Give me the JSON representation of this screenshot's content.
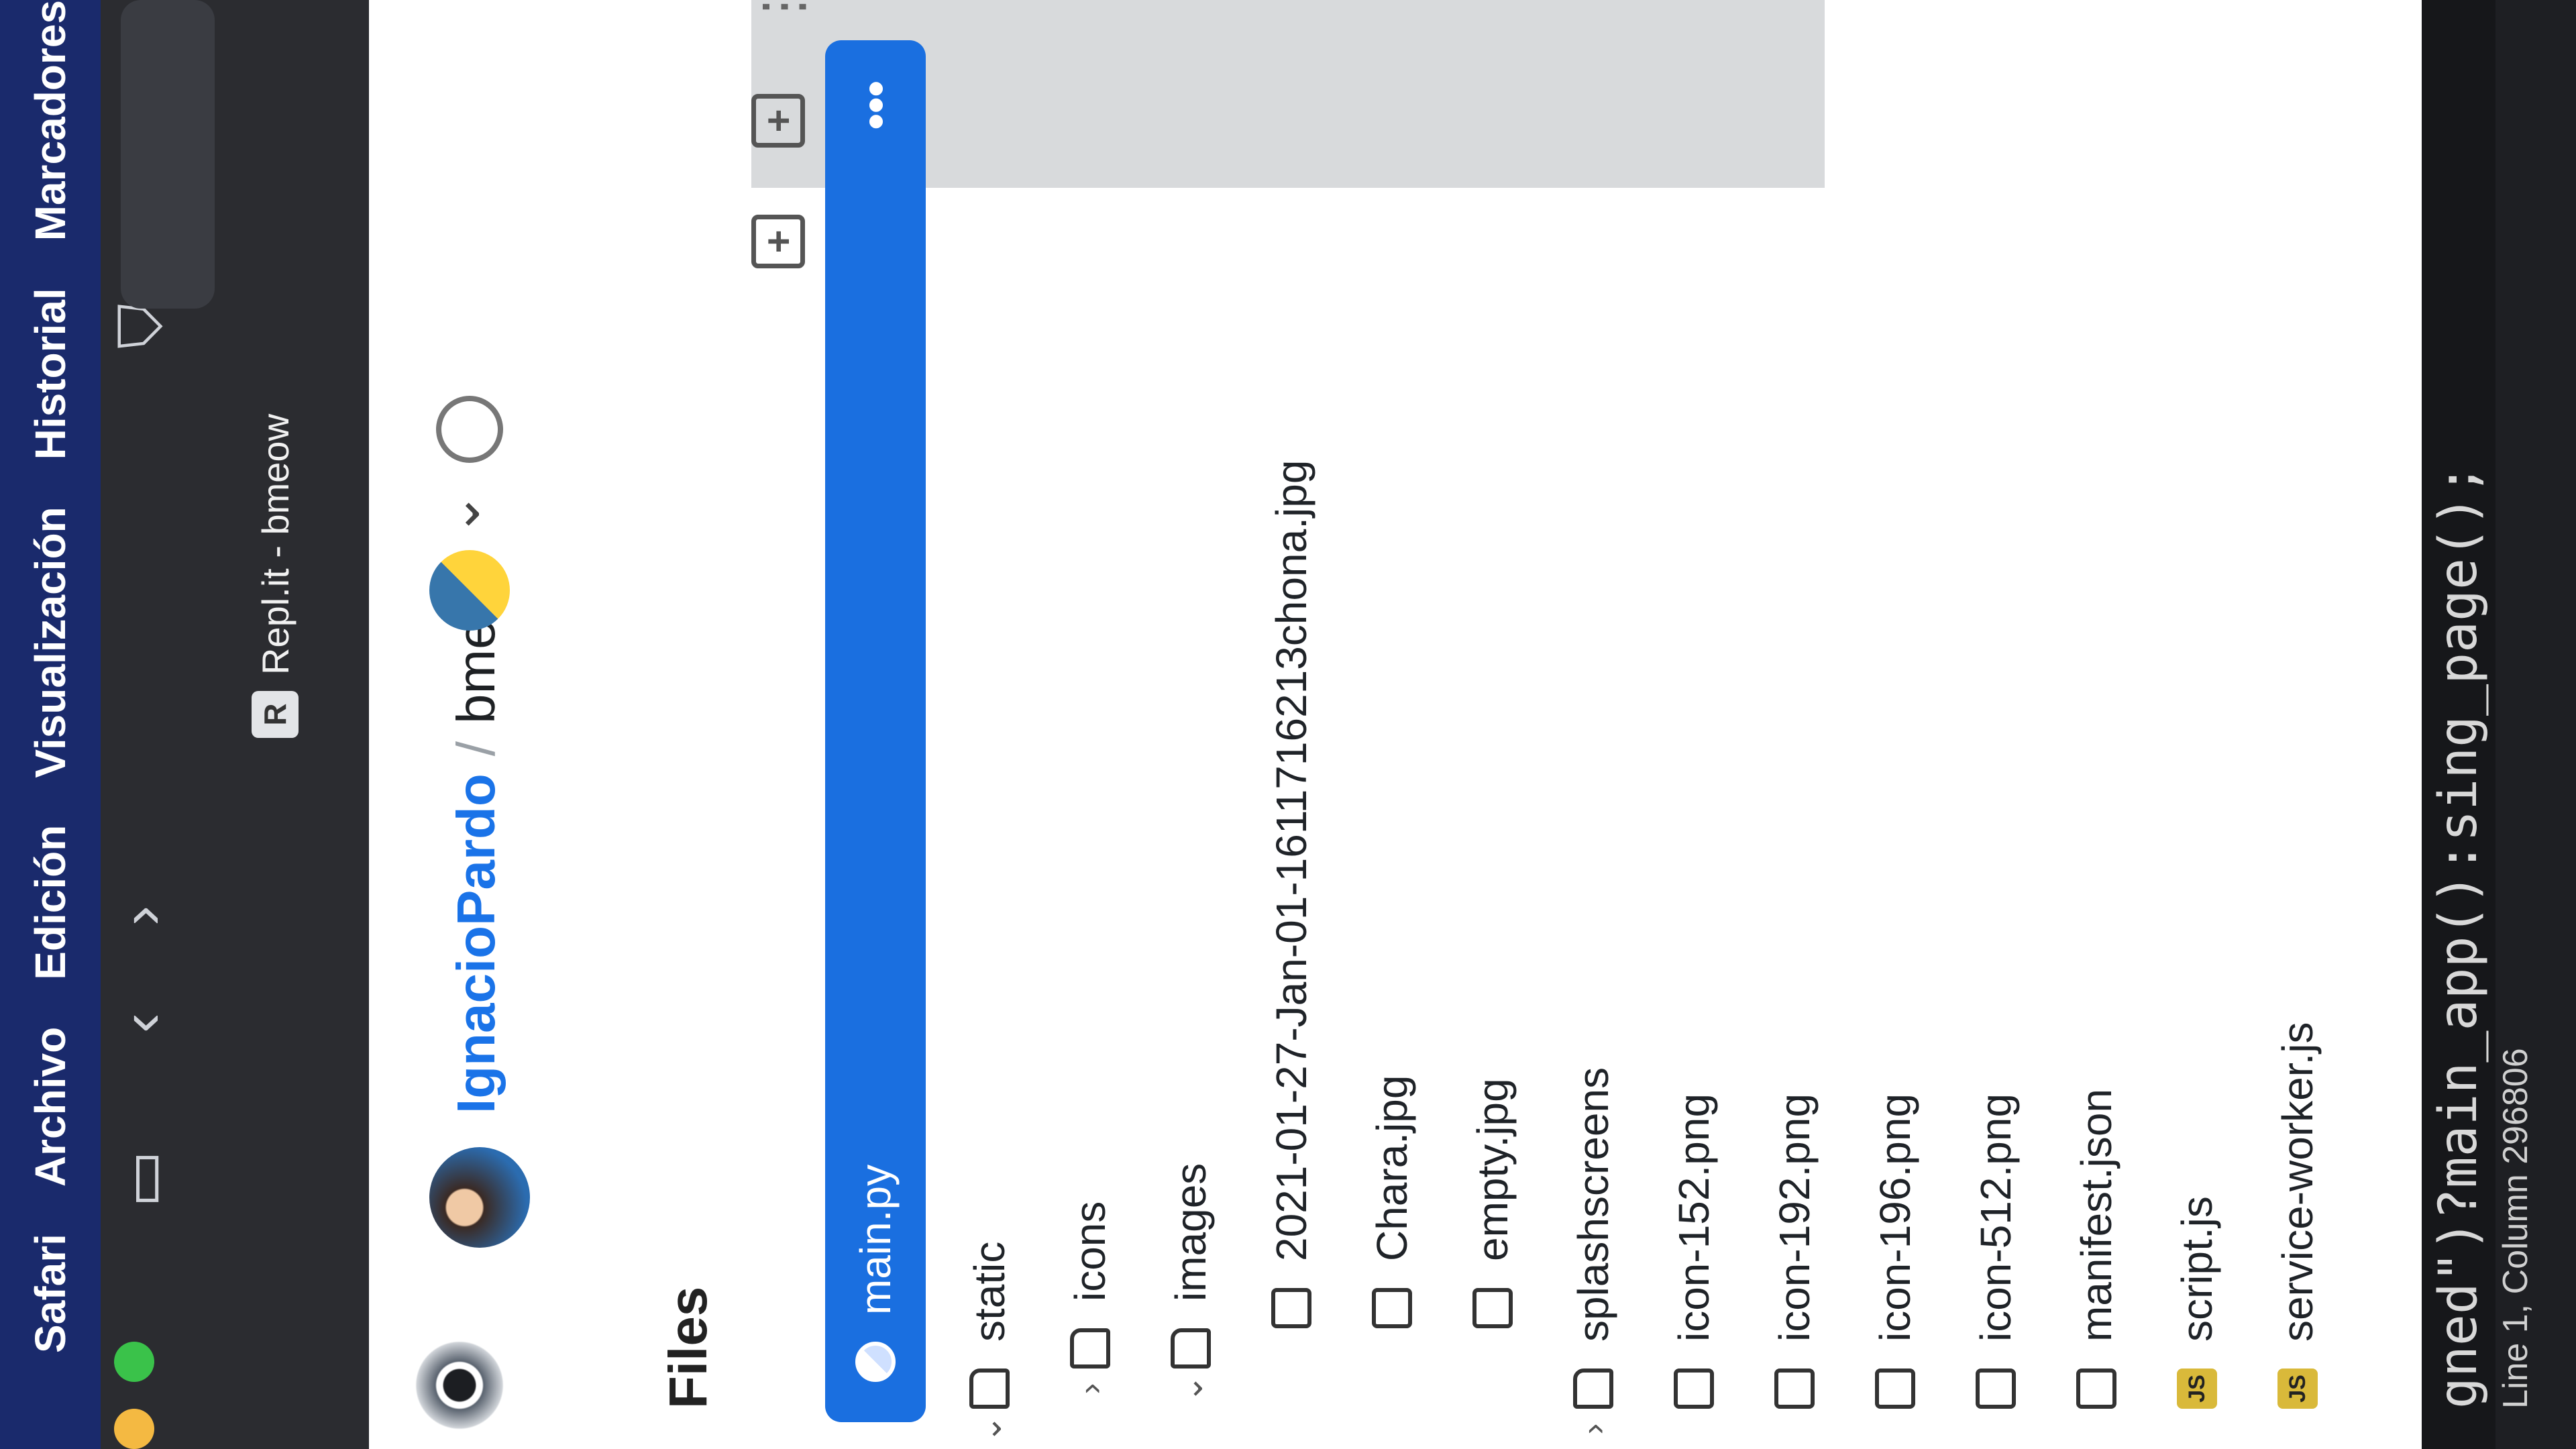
{
  "menubar": {
    "app": "Safari",
    "items": [
      "Archivo",
      "Edición",
      "Visualización",
      "Historial",
      "Marcadores"
    ]
  },
  "browser": {
    "tab_favicon": "R",
    "tab_title": "Repl.it - bmeow"
  },
  "header": {
    "user": "IgnacioPardo",
    "separator": "/",
    "repl": "bmeow"
  },
  "files": {
    "title": "Files",
    "items": [
      {
        "name": "main.py",
        "type": "python",
        "active": true,
        "more": "•••"
      },
      {
        "name": "static",
        "type": "folder",
        "caret": "⌄"
      },
      {
        "name": "icons",
        "type": "folder",
        "caret": "›"
      },
      {
        "name": "images",
        "type": "folder",
        "caret": "⌄"
      },
      {
        "name": "2021-01-27-Jan-01-1611716213chona.jpg",
        "type": "file"
      },
      {
        "name": "Chara.jpg",
        "type": "file"
      },
      {
        "name": "empty.jpg",
        "type": "file"
      },
      {
        "name": "splashscreens",
        "type": "folder",
        "caret": "›"
      },
      {
        "name": "icon-152.png",
        "type": "file"
      },
      {
        "name": "icon-192.png",
        "type": "file"
      },
      {
        "name": "icon-196.png",
        "type": "file"
      },
      {
        "name": "icon-512.png",
        "type": "file"
      },
      {
        "name": "manifest.json",
        "type": "file"
      },
      {
        "name": "script.js",
        "type": "js"
      },
      {
        "name": "service-worker.js",
        "type": "js"
      }
    ]
  },
  "editor": {
    "code_line": "gned\")?main_app():sing_page();",
    "status": "Line 1, Column 296806"
  },
  "colors": {
    "accent": "#1a6fe0",
    "menubar": "#1a2a6c"
  }
}
